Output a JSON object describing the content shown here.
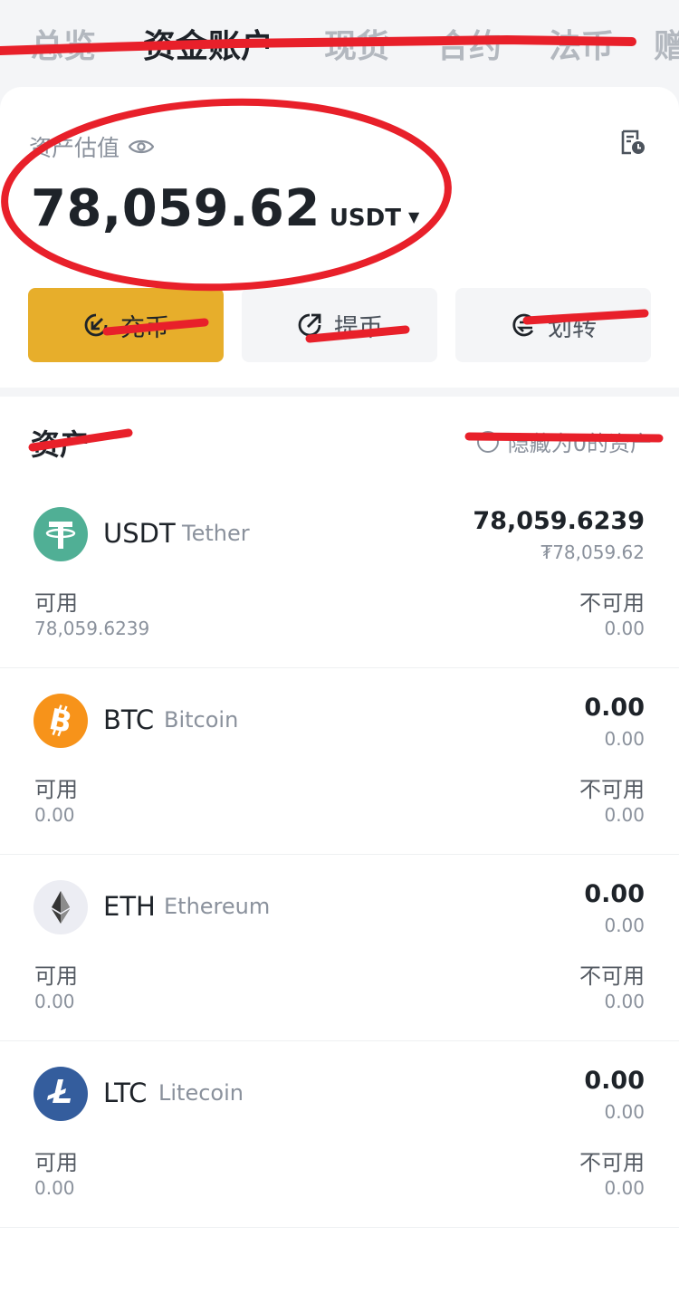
{
  "tabs": [
    {
      "label": "总览"
    },
    {
      "label": "资金账户"
    },
    {
      "label": "现货"
    },
    {
      "label": "合约"
    },
    {
      "label": "法币"
    },
    {
      "label": "赠"
    }
  ],
  "summary": {
    "label": "资产估值",
    "balance": "78,059.62",
    "currency": "USDT",
    "caret": "▼"
  },
  "actions": {
    "deposit": "充币",
    "withdraw": "提币",
    "transfer": "划转"
  },
  "assets": {
    "title": "资产",
    "hide_zero": "隐藏为0的资产",
    "available_label": "可用",
    "unavailable_label": "不可用",
    "items": [
      {
        "symbol": "USDT",
        "name": "Tether",
        "total": "78,059.6239",
        "fiat": "₮78,059.62",
        "available": "78,059.6239",
        "unavailable": "0.00",
        "icon": "tether-icon",
        "color": "#50af95"
      },
      {
        "symbol": "BTC",
        "name": "Bitcoin",
        "total": "0.00",
        "fiat": "0.00",
        "available": "0.00",
        "unavailable": "0.00",
        "icon": "bitcoin-icon",
        "color": "#f7931a"
      },
      {
        "symbol": "ETH",
        "name": "Ethereum",
        "total": "0.00",
        "fiat": "0.00",
        "available": "0.00",
        "unavailable": "0.00",
        "icon": "ethereum-icon",
        "color": "#ecedf3"
      },
      {
        "symbol": "LTC",
        "name": "Litecoin",
        "total": "0.00",
        "fiat": "0.00",
        "available": "0.00",
        "unavailable": "0.00",
        "icon": "litecoin-icon",
        "color": "#345d9d"
      }
    ]
  },
  "colors": {
    "accent": "#e7ae2b",
    "annotation": "#e8202a"
  }
}
